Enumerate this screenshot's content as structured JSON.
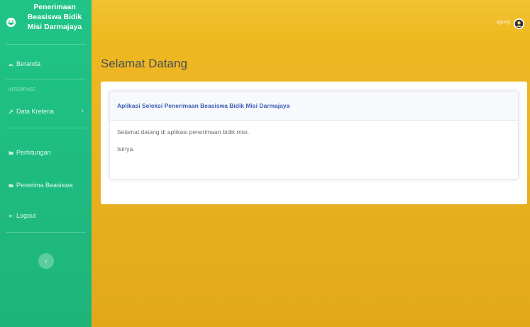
{
  "sidebar": {
    "brand": {
      "line1": "Penerimaan",
      "line2": "Beasiswa Bidik",
      "line3": "Misi Darmajaya",
      "icon": "smiley-icon"
    },
    "heading": "INTERFACE",
    "items": [
      {
        "label": "Beranda",
        "icon": "dashboard-icon"
      },
      {
        "label": "Data Kreteria",
        "icon": "wrench-icon",
        "chevron": "›"
      },
      {
        "label": "Perhitungan",
        "icon": "folder-icon"
      },
      {
        "label": "Penerima Beasiswa",
        "icon": "folder-icon"
      },
      {
        "label": "Logout",
        "icon": "arrow-left-icon"
      }
    ],
    "toggle_label": "‹"
  },
  "topbar": {
    "user_name": "agung",
    "avatar_icon": "user-avatar"
  },
  "main": {
    "title": "Selamat Datang",
    "card": {
      "header": "Aplikasi Seleksi Penerimaan Beasiswa Bidik Misi Darmajaya",
      "body_line1": "Selamat datang di aplikasi penerimaan bidik misi.",
      "body_line2": "Isinya."
    }
  },
  "colors": {
    "sidebar": "#1fbf84",
    "topbar": "#f0c02e",
    "card_header_text": "#3a5db5"
  }
}
